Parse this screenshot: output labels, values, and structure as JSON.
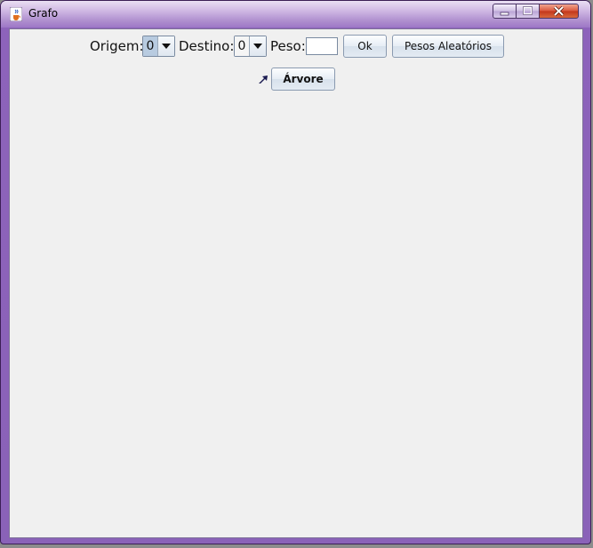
{
  "window": {
    "title": "Grafo"
  },
  "toolbar": {
    "origem_label": "Origem:",
    "origem_value": "0",
    "destino_label": "Destino:",
    "destino_value": "0",
    "peso_label": "Peso:",
    "peso_value": "",
    "ok_label": "Ok",
    "pesos_label": "Pesos Aleatórios",
    "arvore_label": "Árvore"
  },
  "colors": {
    "titlebar": "#b090cf",
    "client_bg": "#f0f0f0",
    "close_button": "#c2351b"
  }
}
